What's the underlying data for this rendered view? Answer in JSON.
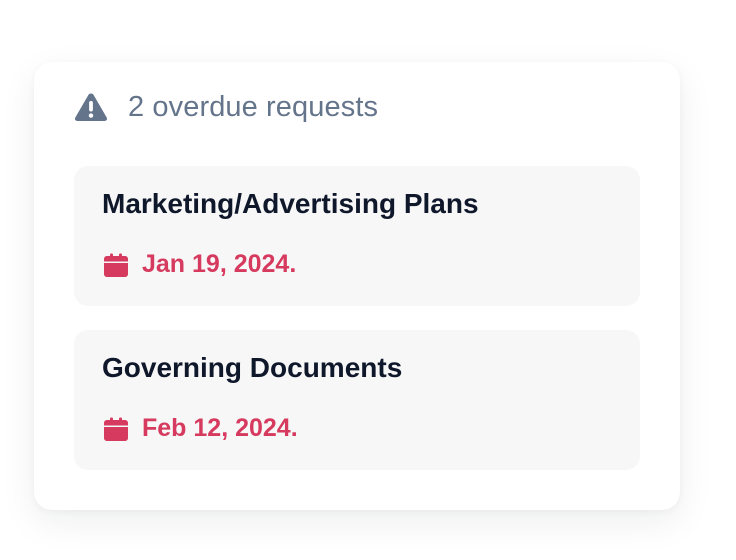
{
  "colors": {
    "header_text": "#64748b",
    "icon_warning": "#64748b",
    "title_text": "#0f172a",
    "overdue_accent": "#d63a5e",
    "item_background": "#f7f7f8"
  },
  "header": {
    "icon": "warning-icon",
    "text": "2 overdue requests"
  },
  "requests": [
    {
      "title": "Marketing/Advertising Plans",
      "date_icon": "calendar-icon",
      "date": "Jan 19, 2024."
    },
    {
      "title": "Governing Documents",
      "date_icon": "calendar-icon",
      "date": "Feb 12, 2024."
    }
  ]
}
